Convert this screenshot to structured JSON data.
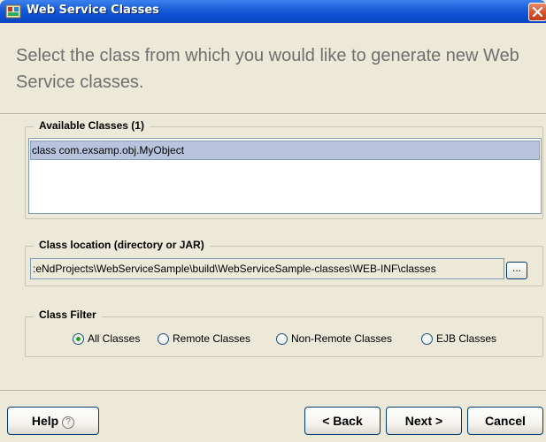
{
  "window": {
    "title": "Web Service Classes",
    "colors": {
      "titlebar": "#0b4ed0",
      "close": "#d8552f",
      "selection": "#b8c4dd"
    }
  },
  "header": {
    "text": "Select the class from which you would like to generate new Web Service classes."
  },
  "available_classes": {
    "label": "Available Classes (1)",
    "items": [
      "class com.exsamp.obj.MyObject"
    ],
    "selected_index": 0
  },
  "class_location": {
    "label": "Class location (directory or JAR)",
    "value": ":eNdProjects\\WebServiceSample\\build\\WebServiceSample-classes\\WEB-INF\\classes",
    "browse_label": "..."
  },
  "class_filter": {
    "label": "Class Filter",
    "options": [
      "All Classes",
      "Remote Classes",
      "Non-Remote Classes",
      "EJB Classes"
    ],
    "selected": "All Classes"
  },
  "buttons": {
    "help": "Help",
    "help_icon": "?",
    "back": "< Back",
    "next": "Next >",
    "cancel": "Cancel"
  },
  "icons": {
    "title": "web-service-icon",
    "close": "close-icon",
    "help": "help-circle-icon"
  }
}
